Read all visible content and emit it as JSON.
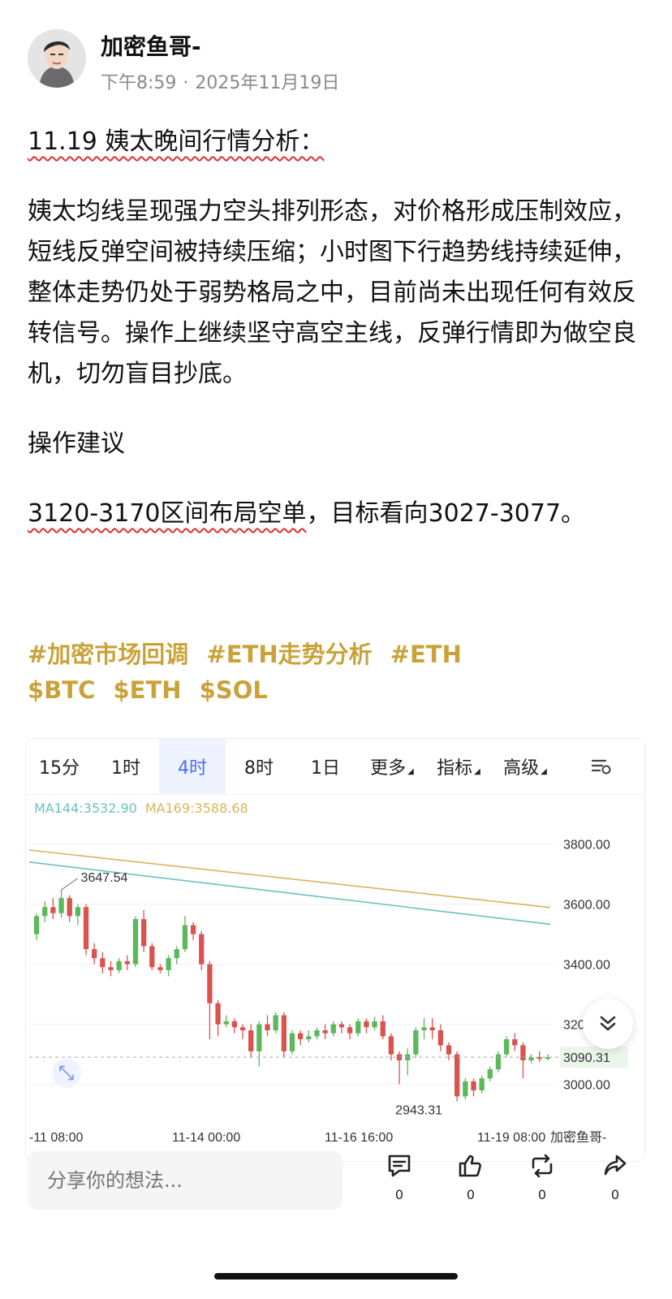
{
  "post": {
    "author": "加密鱼哥-",
    "time": "下午8:59",
    "date": "2025年11月19日",
    "title": "11.19 姨太晚间行情分析：",
    "body": "姨太均线呈现强力空头排列形态，对价格形成压制效应，短线反弹空间被持续压缩；小时图下行趋势线持续延伸，整体走势仍处于弱势格局之中，目前尚未出现任何有效反转信号。操作上继续坚守高空主线，反弹行情即为做空良机，切勿盲目抄底。",
    "section_label": "操作建议",
    "suggestion_highlight": "3120-3170区间布局空单",
    "suggestion_rest": "，目标看向3027-3077。",
    "hashtags_row1": [
      "#加密市场回调",
      "#ETH走势分析",
      "#ETH"
    ],
    "hashtags_row2": [
      "$BTC",
      "$ETH",
      "$SOL"
    ]
  },
  "chart": {
    "tabs": [
      "15分",
      "1时",
      "4时",
      "8时",
      "1日",
      "更多",
      "指标",
      "高级"
    ],
    "active_tab": "4时",
    "ma144_label": "MA144:3532.90",
    "ma169_label": "MA169:3588.68",
    "ma144_color": "#6cc1bd",
    "ma169_color": "#d8b55a",
    "up_color": "#5cb85c",
    "down_color": "#d9534f",
    "high_label": "3647.54",
    "low_label": "2943.31",
    "current_price": "3090.31",
    "watermark": "加密鱼哥-"
  },
  "chart_data": {
    "type": "candlestick",
    "y_ticks": [
      "3800.00",
      "3600.00",
      "3400.00",
      "3200.00",
      "3000.00"
    ],
    "x_ticks": [
      "-11 08:00",
      "11-14 00:00",
      "11-16 16:00",
      "11-19 08:00"
    ],
    "ylim": [
      2880,
      3880
    ],
    "ma144": [
      3740,
      3532.9
    ],
    "ma169": [
      3780,
      3588.68
    ],
    "candles": [
      [
        3500,
        3560,
        3480,
        3570
      ],
      [
        3560,
        3590,
        3540,
        3610
      ],
      [
        3590,
        3570,
        3550,
        3620
      ],
      [
        3570,
        3620,
        3555,
        3647.54
      ],
      [
        3620,
        3560,
        3540,
        3630
      ],
      [
        3560,
        3590,
        3530,
        3600
      ],
      [
        3590,
        3450,
        3430,
        3600
      ],
      [
        3450,
        3420,
        3400,
        3470
      ],
      [
        3420,
        3390,
        3370,
        3440
      ],
      [
        3390,
        3380,
        3360,
        3410
      ],
      [
        3380,
        3410,
        3370,
        3420
      ],
      [
        3410,
        3400,
        3380,
        3430
      ],
      [
        3400,
        3550,
        3390,
        3560
      ],
      [
        3550,
        3460,
        3440,
        3580
      ],
      [
        3460,
        3390,
        3380,
        3470
      ],
      [
        3390,
        3380,
        3370,
        3400
      ],
      [
        3380,
        3420,
        3360,
        3430
      ],
      [
        3420,
        3450,
        3400,
        3460
      ],
      [
        3450,
        3530,
        3440,
        3560
      ],
      [
        3530,
        3500,
        3480,
        3540
      ],
      [
        3500,
        3400,
        3380,
        3510
      ],
      [
        3400,
        3270,
        3150,
        3410
      ],
      [
        3270,
        3200,
        3160,
        3280
      ],
      [
        3200,
        3210,
        3190,
        3230
      ],
      [
        3210,
        3190,
        3170,
        3220
      ],
      [
        3190,
        3180,
        3150,
        3200
      ],
      [
        3180,
        3110,
        3090,
        3200
      ],
      [
        3110,
        3200,
        3060,
        3210
      ],
      [
        3200,
        3180,
        3160,
        3230
      ],
      [
        3180,
        3230,
        3170,
        3240
      ],
      [
        3230,
        3110,
        3090,
        3240
      ],
      [
        3110,
        3170,
        3100,
        3180
      ],
      [
        3170,
        3150,
        3130,
        3180
      ],
      [
        3150,
        3160,
        3140,
        3180
      ],
      [
        3160,
        3180,
        3150,
        3190
      ],
      [
        3180,
        3170,
        3150,
        3200
      ],
      [
        3170,
        3200,
        3160,
        3210
      ],
      [
        3200,
        3190,
        3170,
        3210
      ],
      [
        3190,
        3170,
        3150,
        3200
      ],
      [
        3170,
        3210,
        3160,
        3220
      ],
      [
        3210,
        3190,
        3170,
        3220
      ],
      [
        3190,
        3210,
        3180,
        3225
      ],
      [
        3210,
        3160,
        3150,
        3230
      ],
      [
        3160,
        3100,
        3080,
        3170
      ],
      [
        3100,
        3080,
        3000,
        3110
      ],
      [
        3080,
        3100,
        3030,
        3120
      ],
      [
        3100,
        3180,
        3090,
        3190
      ],
      [
        3180,
        3190,
        3150,
        3220
      ],
      [
        3190,
        3180,
        3150,
        3220
      ],
      [
        3180,
        3130,
        3110,
        3200
      ],
      [
        3130,
        3100,
        3080,
        3140
      ],
      [
        3100,
        2960,
        2943.31,
        3110
      ],
      [
        2960,
        3010,
        2950,
        3020
      ],
      [
        3010,
        2980,
        2960,
        3020
      ],
      [
        2980,
        3020,
        2970,
        3030
      ],
      [
        3020,
        3050,
        3010,
        3060
      ],
      [
        3050,
        3100,
        3040,
        3110
      ],
      [
        3100,
        3150,
        3090,
        3160
      ],
      [
        3150,
        3130,
        3110,
        3170
      ],
      [
        3130,
        3080,
        3020,
        3140
      ],
      [
        3080,
        3090,
        3070,
        3100
      ],
      [
        3090,
        3085,
        3075,
        3110
      ],
      [
        3085,
        3090.31,
        3080,
        3100
      ]
    ]
  },
  "composer": {
    "placeholder": "分享你的想法...",
    "comment_count": "0",
    "like_count": "0",
    "repost_count": "0",
    "share_count": "0"
  }
}
